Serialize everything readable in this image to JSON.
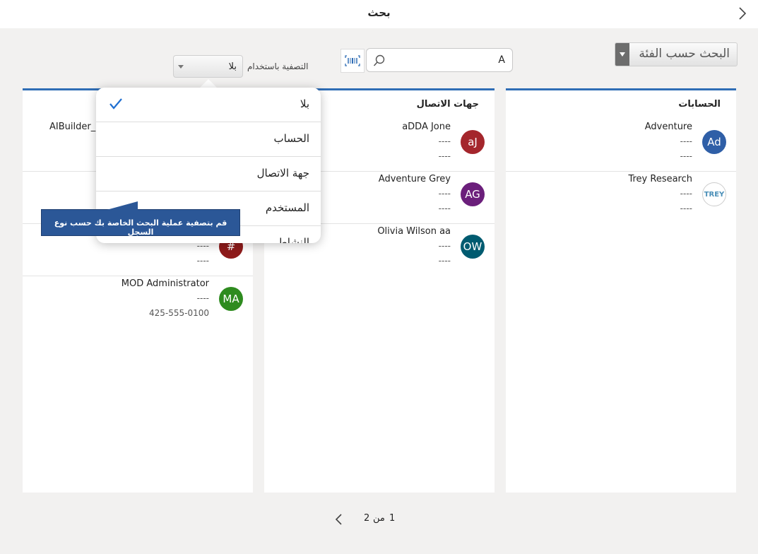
{
  "header": {
    "title": "بحث"
  },
  "category_button": {
    "label": "البحث حسب الفئة"
  },
  "search": {
    "value": "A"
  },
  "filter": {
    "label": "التصفية باستخدام",
    "selected": "بلا"
  },
  "dropdown": {
    "options": [
      {
        "label": "بلا",
        "selected": true
      },
      {
        "label": "الحساب",
        "selected": false
      },
      {
        "label": "جهة الاتصال",
        "selected": false
      },
      {
        "label": "المستخدم",
        "selected": false
      },
      {
        "label": "النشاط",
        "selected": false
      }
    ]
  },
  "tooltip": {
    "text": "قم بتصفية عملية البحث الخاصة بك حسب نوع السجل"
  },
  "panels": {
    "accounts": {
      "title": "الحسابات",
      "records": [
        {
          "initials": "Ad",
          "name": "Adventure",
          "line2": "----",
          "line3": "----",
          "color": "#2f5fa7"
        },
        {
          "initials": "TREY",
          "name": "Trey Research",
          "line2": "----",
          "line3": "----",
          "color": "#ffffff"
        }
      ]
    },
    "contacts": {
      "title": "جهات الاتصال",
      "records": [
        {
          "initials": "aJ",
          "name": "aDDA Jone",
          "line2": "----",
          "line3": "----",
          "color": "#a4262c"
        },
        {
          "initials": "AG",
          "name": "Adventure Grey",
          "line2": "----",
          "line3": "----",
          "color": "#6b1f7b"
        },
        {
          "initials": "OW",
          "name": "Olivia Wilson aa",
          "line2": "----",
          "line3": "----",
          "color": "#005b70"
        }
      ]
    },
    "users": {
      "records": [
        {
          "initials": "",
          "name": "AIBuilder_S",
          "line2": "",
          "line3": "",
          "color": "#ffffff"
        },
        {
          "initials": "",
          "name": "",
          "line2": "",
          "line3": "",
          "color": "#ffffff"
        },
        {
          "initials": "#",
          "name": "",
          "line2": "----",
          "line3": "----",
          "color": "#8e1b1b"
        },
        {
          "initials": "MA",
          "name": "MOD Administrator",
          "line2": "----",
          "line3": "425-555-0100",
          "color": "#2e8b1f"
        }
      ]
    }
  },
  "pagination": {
    "current": "1",
    "of": "من",
    "total": "2"
  },
  "icons": {
    "back": "chevron-right-icon",
    "search": "search-icon",
    "scan": "barcode-scan-icon",
    "check": "checkmark-icon",
    "next": "chevron-left-icon"
  }
}
